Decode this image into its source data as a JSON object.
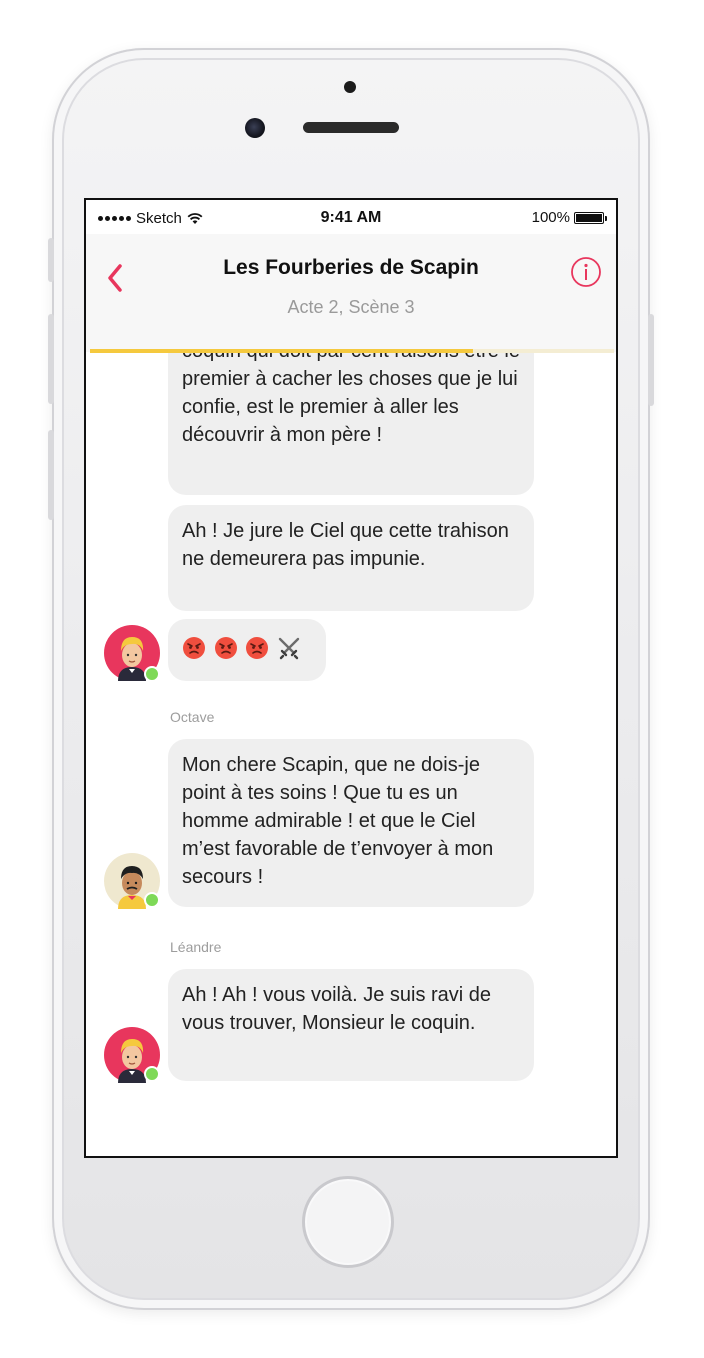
{
  "status_bar": {
    "carrier": "Sketch",
    "time": "9:41 AM",
    "battery": "100%"
  },
  "nav": {
    "title": "Les Fourberies de Scapin",
    "subtitle": "Acte 2, Scène 3",
    "progress": 0.73
  },
  "messages": [
    {
      "text": "coquin qui doit par cent raisons être le premier à cacher les choses que je lui confie, est le premier à aller les découvrir à mon père !"
    },
    {
      "text": "Ah ! Je jure le Ciel que cette trahison ne demeurera pas impunie."
    },
    {
      "emojis": [
        "angry-face",
        "angry-face",
        "angry-face",
        "crossed-swords"
      ]
    },
    {
      "sender": "Octave",
      "text": "Mon chere Scapin, que ne dois-je point à tes soins ! Que tu es un homme admirable ! et que le Ciel m’est favorable de t’envoyer à mon secours !"
    },
    {
      "sender": "Léandre",
      "text": "Ah ! Ah ! vous voilà. Je suis ravi de vous trouver, Monsieur le coquin."
    }
  ],
  "colors": {
    "accent": "#e8365d",
    "progress": "#f5c93e",
    "bubble": "#efefef",
    "online": "#7ed957"
  }
}
